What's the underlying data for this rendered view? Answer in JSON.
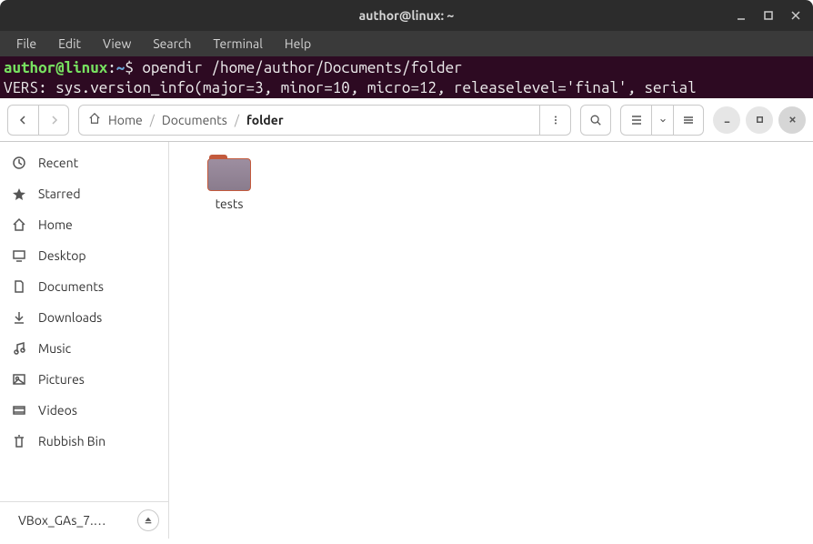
{
  "window": {
    "title": "author@linux: ~"
  },
  "terminal": {
    "menu": [
      "File",
      "Edit",
      "View",
      "Search",
      "Terminal",
      "Help"
    ],
    "prompt_user_host": "author@linux",
    "prompt_sep": ":",
    "prompt_path": "~",
    "prompt_dollar": "$",
    "command": "opendir /home/author/Documents/folder",
    "output_line": "VERS: sys.version_info(major=3, minor=10, micro=12, releaselevel='final', serial"
  },
  "files": {
    "breadcrumb": {
      "home": "Home",
      "seg1": "Documents",
      "seg2": "folder"
    },
    "sidebar": {
      "recent": "Recent",
      "starred": "Starred",
      "home": "Home",
      "desktop": "Desktop",
      "documents": "Documents",
      "downloads": "Downloads",
      "music": "Music",
      "pictures": "Pictures",
      "videos": "Videos",
      "trash": "Rubbish Bin",
      "mount": "VBox_GAs_7.…"
    },
    "items": [
      {
        "name": "tests",
        "type": "folder"
      }
    ]
  }
}
